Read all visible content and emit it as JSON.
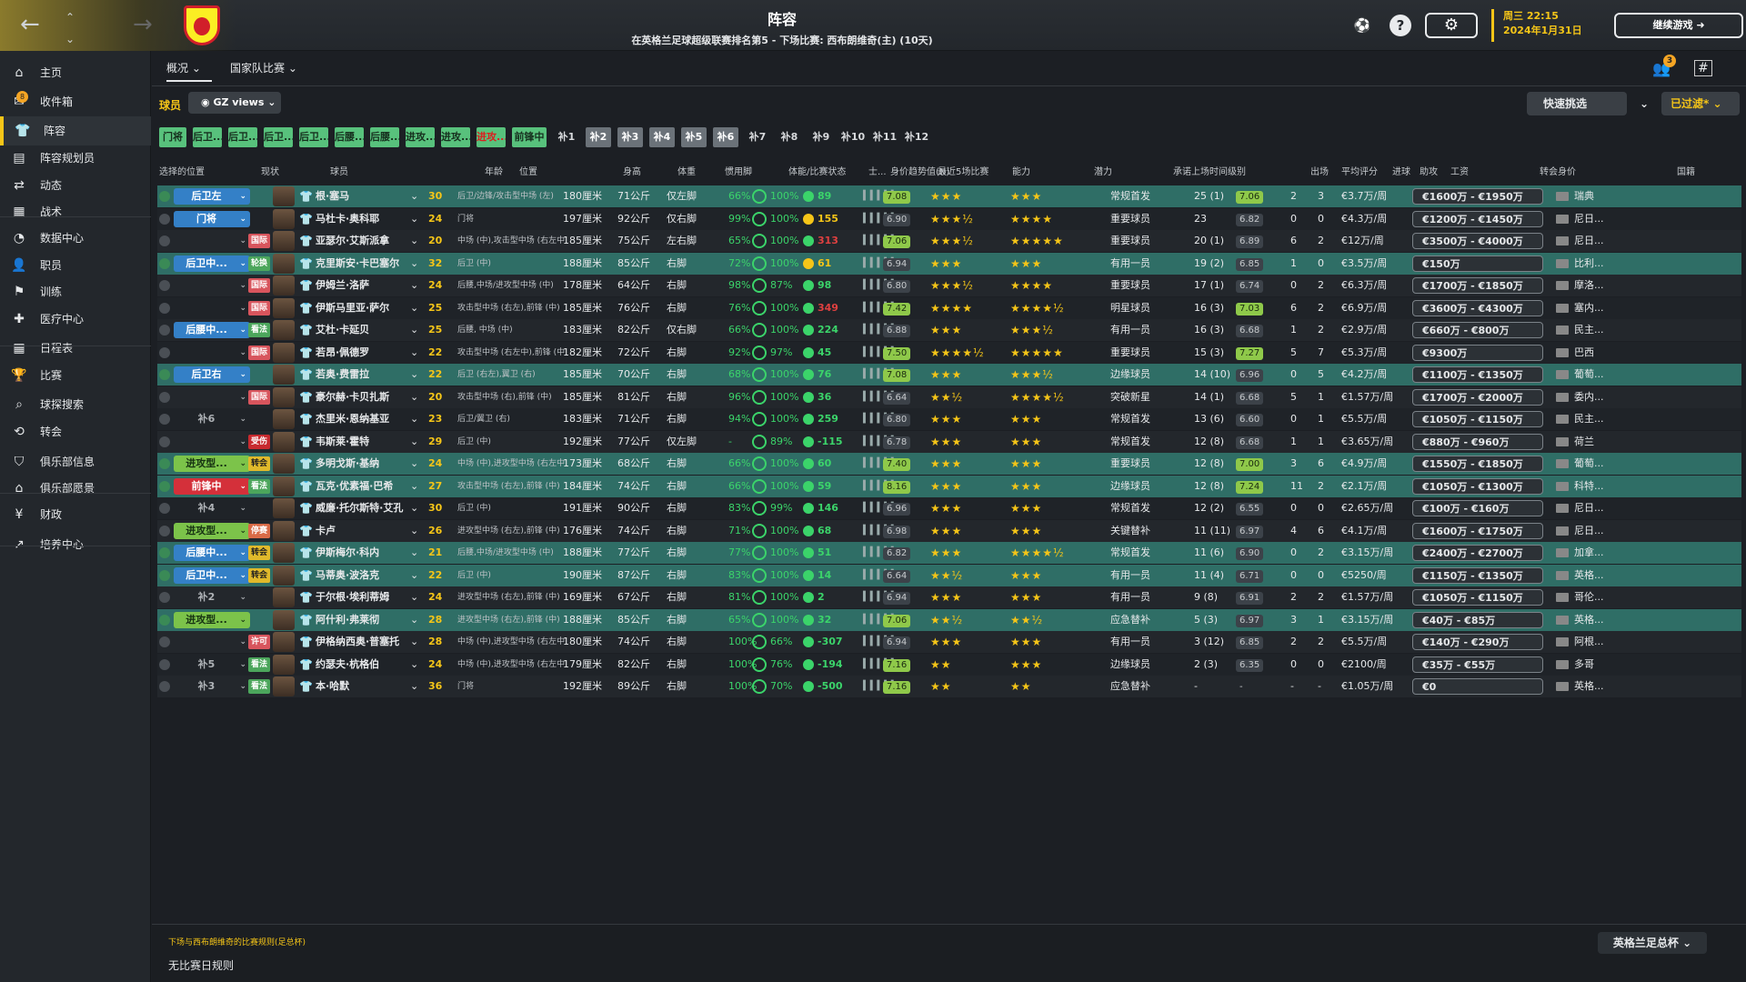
{
  "header": {
    "title": "阵容",
    "subtitle": "在英格兰足球超级联赛排名第5 - 下场比赛: 西布朗维奇(主) (10天)",
    "date_line1": "周三 22:15",
    "date_line2": "2024年1月31日",
    "continue_label": "继续游戏",
    "notif_count": "3",
    "back_icon": "←",
    "forward_icon": "→"
  },
  "sidebar": {
    "items": [
      {
        "label": "主页",
        "icon": "home-icon"
      },
      {
        "label": "收件箱",
        "icon": "inbox-icon",
        "badge": "8"
      },
      {
        "label": "阵容",
        "icon": "squad-icon",
        "active": true
      },
      {
        "label": "阵容规划员",
        "icon": "planner-icon"
      },
      {
        "label": "动态",
        "icon": "dynamics-icon"
      },
      {
        "label": "战术",
        "icon": "tactics-icon"
      },
      {
        "label": "数据中心",
        "icon": "data-icon"
      },
      {
        "label": "职员",
        "icon": "staff-icon"
      },
      {
        "label": "训练",
        "icon": "training-icon"
      },
      {
        "label": "医疗中心",
        "icon": "medical-icon"
      },
      {
        "label": "日程表",
        "icon": "calendar-icon"
      },
      {
        "label": "比赛",
        "icon": "trophy-icon"
      },
      {
        "label": "球探搜索",
        "icon": "scouting-icon"
      },
      {
        "label": "转会",
        "icon": "transfer-icon"
      },
      {
        "label": "俱乐部信息",
        "icon": "shield-icon"
      },
      {
        "label": "俱乐部愿景",
        "icon": "vision-icon"
      },
      {
        "label": "财政",
        "icon": "finance-icon"
      },
      {
        "label": "培养中心",
        "icon": "development-icon"
      }
    ]
  },
  "tabs": [
    {
      "label": "概况"
    },
    {
      "label": "国家队比赛"
    }
  ],
  "toolbar": {
    "players_label": "球员",
    "view_label": "GZ views",
    "quick_pick": "快速挑选",
    "filtered": "已过滤*"
  },
  "chips": [
    "门将",
    "后卫...",
    "后卫...",
    "后卫...",
    "后卫...",
    "后腰...",
    "后腰...",
    "进攻...",
    "进攻...",
    "进攻...",
    "前锋中",
    "补1",
    "补2",
    "补3",
    "补4",
    "补5",
    "补6",
    "补7",
    "补8",
    "补9",
    "补10",
    "补11",
    "补12"
  ],
  "columns": {
    "selpos": "选择的位置",
    "status": "现状",
    "player": "球员",
    "age": "年龄",
    "position": "位置",
    "height": "身高",
    "weight": "体重",
    "foot": "惯用脚",
    "fitness": "体能/比赛状态",
    "sharp": "士...",
    "trend": "身价趋势值(N)",
    "last5": "最近5场比赛",
    "ability": "能力",
    "potential": "潜力",
    "playing_time": "承诺上场时间级别",
    "apps": "出场",
    "avg": "平均评分",
    "goals": "进球",
    "assists": "助攻",
    "wage": "工资",
    "value": "转会身价",
    "nation": "国籍"
  },
  "players": [
    {
      "sel": "后卫左",
      "selc": "blue",
      "tag": "",
      "name": "根·塞马",
      "age": "30",
      "pos": "后卫/边锋/攻击型中场 (左)",
      "h": "180厘米",
      "w": "71公斤",
      "foot": "仅左脚",
      "fit": "66%",
      "cond": "100%",
      "form": "89",
      "formc": "g",
      "avgl": "7.08",
      "avglc": "g",
      "ab": "★★★",
      "pot": "★★★",
      "pt": "常规首发",
      "apps": "25 (1)",
      "avg": "7.06",
      "avgc": "g",
      "g": "2",
      "a": "3",
      "wage": "€3.7万/周",
      "val": "€1600万 - €1950万",
      "nat": "瑞典",
      "rowc": "sel"
    },
    {
      "sel": "门将",
      "selc": "blue",
      "tag": "",
      "name": "马杜卡·奥科耶",
      "age": "24",
      "pos": "门将",
      "h": "197厘米",
      "w": "92公斤",
      "foot": "仅右脚",
      "fit": "99%",
      "cond": "100%",
      "form": "155",
      "formc": "y",
      "avgl": "6.90",
      "avglc": "d",
      "ab": "★★★½",
      "pot": "★★★★",
      "pt": "重要球员",
      "apps": "23",
      "avg": "6.82",
      "avgc": "d",
      "g": "0",
      "a": "0",
      "wage": "€4.3万/周",
      "val": "€1200万 - €1450万",
      "nat": "尼日...",
      "rowc": "plain"
    },
    {
      "sel": "",
      "selc": "none",
      "tag": "国际",
      "tagc": "int",
      "name": "亚瑟尔·艾斯派拿",
      "age": "20",
      "pos": "中场 (中),攻击型中场 (右左中)",
      "h": "185厘米",
      "w": "75公斤",
      "foot": "左右脚",
      "fit": "65%",
      "cond": "100%",
      "form": "313",
      "formc": "r",
      "avgl": "7.06",
      "avglc": "g",
      "ab": "★★★½",
      "pot": "★★★★★",
      "pt": "重要球员",
      "apps": "20 (1)",
      "avg": "6.89",
      "avgc": "d",
      "g": "6",
      "a": "2",
      "wage": "€12万/周",
      "val": "€3500万 - €4000万",
      "nat": "尼日...",
      "rowc": "alt"
    },
    {
      "sel": "后卫中...",
      "selc": "blue",
      "tag": "轮换",
      "tagc": "rot",
      "name": "克里斯安·卡巴塞尔",
      "age": "32",
      "pos": "后卫 (中)",
      "h": "188厘米",
      "w": "85公斤",
      "foot": "右脚",
      "fit": "72%",
      "cond": "100%",
      "form": "61",
      "formc": "y",
      "avgl": "6.94",
      "avglc": "d",
      "ab": "★★★",
      "pot": "★★★",
      "pt": "有用一员",
      "apps": "19 (2)",
      "avg": "6.85",
      "avgc": "d",
      "g": "1",
      "a": "0",
      "wage": "€3.5万/周",
      "val": "€150万",
      "nat": "比利...",
      "rowc": "sel"
    },
    {
      "sel": "",
      "selc": "none",
      "tag": "国际",
      "tagc": "int",
      "name": "伊姆兰·洛萨",
      "age": "24",
      "pos": "后腰,中场/进攻型中场 (中)",
      "h": "178厘米",
      "w": "64公斤",
      "foot": "右脚",
      "fit": "98%",
      "cond": "87%",
      "form": "98",
      "formc": "g",
      "avgl": "6.80",
      "avglc": "d",
      "ab": "★★★½",
      "pot": "★★★★",
      "pt": "重要球员",
      "apps": "17 (1)",
      "avg": "6.74",
      "avgc": "d",
      "g": "0",
      "a": "2",
      "wage": "€6.3万/周",
      "val": "€1700万 - €1850万",
      "nat": "摩洛...",
      "rowc": "alt"
    },
    {
      "sel": "",
      "selc": "none",
      "tag": "国际",
      "tagc": "int",
      "name": "伊斯马里亚·萨尔",
      "age": "25",
      "pos": "攻击型中场 (右左),前锋 (中)",
      "h": "185厘米",
      "w": "76公斤",
      "foot": "右脚",
      "fit": "76%",
      "cond": "100%",
      "form": "349",
      "formc": "r",
      "avgl": "7.42",
      "avglc": "g",
      "ab": "★★★★",
      "pot": "★★★★½",
      "pt": "明星球员",
      "apps": "16 (3)",
      "avg": "7.03",
      "avgc": "g",
      "g": "6",
      "a": "2",
      "wage": "€6.9万/周",
      "val": "€3600万 - €4300万",
      "nat": "塞内...",
      "rowc": "plain"
    },
    {
      "sel": "后腰中...",
      "selc": "blue",
      "tag": "看法",
      "tagc": "rot",
      "name": "艾杜·卡延贝",
      "age": "25",
      "pos": "后腰, 中场 (中)",
      "h": "183厘米",
      "w": "82公斤",
      "foot": "仅右脚",
      "fit": "66%",
      "cond": "100%",
      "form": "224",
      "formc": "g",
      "avgl": "6.88",
      "avglc": "d",
      "ab": "★★★",
      "pot": "★★★½",
      "pt": "有用一员",
      "apps": "16 (3)",
      "avg": "6.68",
      "avgc": "d",
      "g": "1",
      "a": "2",
      "wage": "€2.9万/周",
      "val": "€660万 - €800万",
      "nat": "民主...",
      "rowc": "alt"
    },
    {
      "sel": "",
      "selc": "none",
      "tag": "国际",
      "tagc": "int",
      "name": "若昂·佩德罗",
      "age": "22",
      "pos": "攻击型中场 (右左中),前锋 (中)",
      "h": "182厘米",
      "w": "72公斤",
      "foot": "右脚",
      "fit": "92%",
      "cond": "97%",
      "form": "45",
      "formc": "g",
      "avgl": "7.50",
      "avglc": "g",
      "ab": "★★★★½",
      "pot": "★★★★★",
      "pt": "重要球员",
      "apps": "15 (3)",
      "avg": "7.27",
      "avgc": "g",
      "g": "5",
      "a": "7",
      "wage": "€5.3万/周",
      "val": "€9300万",
      "nat": "巴西",
      "rowc": "plain"
    },
    {
      "sel": "后卫右",
      "selc": "blue",
      "tag": "",
      "name": "若奥·费雷拉",
      "age": "22",
      "pos": "后卫 (右左),翼卫 (右)",
      "h": "185厘米",
      "w": "70公斤",
      "foot": "右脚",
      "fit": "68%",
      "cond": "100%",
      "form": "76",
      "formc": "g",
      "avgl": "7.08",
      "avglc": "g",
      "ab": "★★★",
      "pot": "★★★½",
      "pt": "边缘球员",
      "apps": "14 (10)",
      "avg": "6.96",
      "avgc": "d",
      "g": "0",
      "a": "5",
      "wage": "€4.2万/周",
      "val": "€1100万 - €1350万",
      "nat": "葡萄...",
      "rowc": "sel"
    },
    {
      "sel": "",
      "selc": "none",
      "tag": "国际",
      "tagc": "int",
      "name": "豪尔赫·卡贝扎斯",
      "age": "20",
      "pos": "攻击型中场 (右),前锋 (中)",
      "h": "185厘米",
      "w": "81公斤",
      "foot": "右脚",
      "fit": "96%",
      "cond": "100%",
      "form": "36",
      "formc": "g",
      "avgl": "6.64",
      "avglc": "d",
      "ab": "★★½",
      "pot": "★★★★½",
      "pt": "突破新星",
      "apps": "14 (1)",
      "avg": "6.68",
      "avgc": "d",
      "g": "5",
      "a": "1",
      "wage": "€1.57万/周",
      "val": "€1700万 - €2000万",
      "nat": "委内...",
      "rowc": "alt"
    },
    {
      "sel": "补6",
      "selc": "none",
      "tag": "",
      "name": "杰里米·恩纳基亚",
      "age": "23",
      "pos": "后卫/翼卫 (右)",
      "h": "183厘米",
      "w": "71公斤",
      "foot": "右脚",
      "fit": "94%",
      "cond": "100%",
      "form": "259",
      "formc": "g",
      "avgl": "6.80",
      "avglc": "d",
      "ab": "★★★",
      "pot": "★★★",
      "pt": "常规首发",
      "apps": "13 (6)",
      "avg": "6.60",
      "avgc": "d",
      "g": "0",
      "a": "1",
      "wage": "€5.5万/周",
      "val": "€1050万 - €1150万",
      "nat": "民主...",
      "rowc": "plain"
    },
    {
      "sel": "",
      "selc": "none",
      "tag": "受伤",
      "tagc": "inj",
      "name": "韦斯莱·霍特",
      "age": "29",
      "pos": "后卫 (中)",
      "h": "192厘米",
      "w": "77公斤",
      "foot": "仅左脚",
      "fit": "-",
      "cond": "89%",
      "form": "-115",
      "formc": "g",
      "avgl": "6.78",
      "avglc": "d",
      "ab": "★★★",
      "pot": "★★★",
      "pt": "常规首发",
      "apps": "12 (8)",
      "avg": "6.68",
      "avgc": "d",
      "g": "1",
      "a": "1",
      "wage": "€3.65万/周",
      "val": "€880万 - €960万",
      "nat": "荷兰",
      "rowc": "alt"
    },
    {
      "sel": "进攻型...",
      "selc": "green",
      "tag": "转会",
      "tagc": "trans",
      "name": "多明戈斯·基纳",
      "age": "24",
      "pos": "中场 (中),进攻型中场 (右左中)",
      "h": "173厘米",
      "w": "68公斤",
      "foot": "右脚",
      "fit": "66%",
      "cond": "100%",
      "form": "60",
      "formc": "g",
      "avgl": "7.40",
      "avglc": "g",
      "ab": "★★★",
      "pot": "★★★",
      "pt": "重要球员",
      "apps": "12 (8)",
      "avg": "7.00",
      "avgc": "g",
      "g": "3",
      "a": "6",
      "wage": "€4.9万/周",
      "val": "€1550万 - €1850万",
      "nat": "葡萄...",
      "rowc": "sel"
    },
    {
      "sel": "前锋中",
      "selc": "red",
      "tag": "看法",
      "tagc": "rot",
      "name": "瓦克·优素福·巴希",
      "age": "27",
      "pos": "攻击型中场 (右左),前锋 (中)",
      "h": "184厘米",
      "w": "74公斤",
      "foot": "右脚",
      "fit": "66%",
      "cond": "100%",
      "form": "59",
      "formc": "g",
      "avgl": "8.16",
      "avglc": "g",
      "ab": "★★★",
      "pot": "★★★",
      "pt": "边缘球员",
      "apps": "12 (8)",
      "avg": "7.24",
      "avgc": "g",
      "g": "11",
      "a": "2",
      "wage": "€2.1万/周",
      "val": "€1050万 - €1300万",
      "nat": "科特...",
      "rowc": "sel"
    },
    {
      "sel": "补4",
      "selc": "none",
      "tag": "",
      "name": "威廉·托尔斯特·艾孔",
      "age": "30",
      "pos": "后卫 (中)",
      "h": "191厘米",
      "w": "90公斤",
      "foot": "右脚",
      "fit": "83%",
      "cond": "99%",
      "form": "146",
      "formc": "g",
      "avgl": "6.96",
      "avglc": "d",
      "ab": "★★★",
      "pot": "★★★",
      "pt": "常规首发",
      "apps": "12 (2)",
      "avg": "6.55",
      "avgc": "d",
      "g": "0",
      "a": "0",
      "wage": "€2.65万/周",
      "val": "€100万 - €160万",
      "nat": "尼日...",
      "rowc": "plain"
    },
    {
      "sel": "进攻型...",
      "selc": "green",
      "tag": "停赛",
      "tagc": "loan",
      "name": "卡卢",
      "age": "26",
      "pos": "进攻型中场 (右左),前锋 (中)",
      "h": "176厘米",
      "w": "74公斤",
      "foot": "右脚",
      "fit": "71%",
      "cond": "100%",
      "form": "68",
      "formc": "g",
      "avgl": "6.98",
      "avglc": "d",
      "ab": "★★★",
      "pot": "★★★",
      "pt": "关键替补",
      "apps": "11 (11)",
      "avg": "6.97",
      "avgc": "d",
      "g": "4",
      "a": "6",
      "wage": "€4.1万/周",
      "val": "€1600万 - €1750万",
      "nat": "尼日...",
      "rowc": "alt"
    },
    {
      "sel": "后腰中...",
      "selc": "blue",
      "tag": "转会",
      "tagc": "trans",
      "name": "伊斯梅尔·科内",
      "age": "21",
      "pos": "后腰,中场/进攻型中场 (中)",
      "h": "188厘米",
      "w": "77公斤",
      "foot": "右脚",
      "fit": "77%",
      "cond": "100%",
      "form": "51",
      "formc": "g",
      "avgl": "6.82",
      "avglc": "d",
      "ab": "★★★",
      "pot": "★★★★½",
      "pt": "常规首发",
      "apps": "11 (6)",
      "avg": "6.90",
      "avgc": "d",
      "g": "0",
      "a": "2",
      "wage": "€3.15万/周",
      "val": "€2400万 - €2700万",
      "nat": "加拿...",
      "rowc": "sel"
    },
    {
      "sel": "后卫中...",
      "selc": "blue",
      "tag": "转会",
      "tagc": "trans",
      "name": "马蒂奥·波洛克",
      "age": "22",
      "pos": "后卫 (中)",
      "h": "190厘米",
      "w": "87公斤",
      "foot": "右脚",
      "fit": "83%",
      "cond": "100%",
      "form": "14",
      "formc": "g",
      "avgl": "6.64",
      "avglc": "d",
      "ab": "★★½",
      "pot": "★★★",
      "pt": "有用一员",
      "apps": "11 (4)",
      "avg": "6.71",
      "avgc": "d",
      "g": "0",
      "a": "0",
      "wage": "€5250/周",
      "val": "€1150万 - €1350万",
      "nat": "英格...",
      "rowc": "sel"
    },
    {
      "sel": "补2",
      "selc": "none",
      "tag": "",
      "name": "于尔根·埃利蒂姆",
      "age": "24",
      "pos": "进攻型中场 (右左),前锋 (中)",
      "h": "169厘米",
      "w": "67公斤",
      "foot": "右脚",
      "fit": "81%",
      "cond": "100%",
      "form": "2",
      "formc": "g",
      "avgl": "6.94",
      "avglc": "d",
      "ab": "★★★",
      "pot": "★★★",
      "pt": "有用一员",
      "apps": "9 (8)",
      "avg": "6.91",
      "avgc": "d",
      "g": "2",
      "a": "2",
      "wage": "€1.57万/周",
      "val": "€1050万 - €1150万",
      "nat": "哥伦...",
      "rowc": "alt"
    },
    {
      "sel": "进攻型...",
      "selc": "green",
      "tag": "",
      "name": "阿什利·弗莱彻",
      "age": "28",
      "pos": "进攻型中场 (右左),前锋 (中)",
      "h": "188厘米",
      "w": "85公斤",
      "foot": "右脚",
      "fit": "65%",
      "cond": "100%",
      "form": "32",
      "formc": "g",
      "avgl": "7.06",
      "avglc": "g",
      "ab": "★★½",
      "pot": "★★½",
      "pt": "应急替补",
      "apps": "5 (3)",
      "avg": "6.97",
      "avgc": "d",
      "g": "3",
      "a": "1",
      "wage": "€3.15万/周",
      "val": "€40万 - €85万",
      "nat": "英格...",
      "rowc": "sel"
    },
    {
      "sel": "",
      "selc": "none",
      "tag": "许可",
      "tagc": "int",
      "name": "伊格纳西奥·普塞托",
      "age": "28",
      "pos": "中场 (中),进攻型中场 (右左中)",
      "h": "180厘米",
      "w": "74公斤",
      "foot": "右脚",
      "fit": "100%",
      "cond": "66%",
      "form": "-307",
      "formc": "g",
      "avgl": "6.94",
      "avglc": "d",
      "ab": "★★★",
      "pot": "★★★",
      "pt": "有用一员",
      "apps": "3 (12)",
      "avg": "6.85",
      "avgc": "d",
      "g": "2",
      "a": "2",
      "wage": "€5.5万/周",
      "val": "€140万 - €290万",
      "nat": "阿根...",
      "rowc": "alt"
    },
    {
      "sel": "补5",
      "selc": "none",
      "tag": "看法",
      "tagc": "rot",
      "name": "约瑟夫·杭格伯",
      "age": "24",
      "pos": "中场 (中),进攻型中场 (右左中)",
      "h": "179厘米",
      "w": "82公斤",
      "foot": "右脚",
      "fit": "100%",
      "cond": "76%",
      "form": "-194",
      "formc": "g",
      "avgl": "7.16",
      "avglc": "g",
      "ab": "★★",
      "pot": "★★★",
      "pt": "边缘球员",
      "apps": "2 (3)",
      "avg": "6.35",
      "avgc": "d",
      "g": "0",
      "a": "0",
      "wage": "€2100/周",
      "val": "€35万 - €55万",
      "nat": "多哥",
      "rowc": "plain"
    },
    {
      "sel": "补3",
      "selc": "none",
      "tag": "看法",
      "tagc": "rot",
      "name": "本·哈默",
      "age": "36",
      "pos": "门将",
      "h": "192厘米",
      "w": "89公斤",
      "foot": "右脚",
      "fit": "100%",
      "cond": "70%",
      "form": "-500",
      "formc": "g",
      "avgl": "7.16",
      "avglc": "g",
      "ab": "★★",
      "pot": "★★",
      "pt": "应急替补",
      "apps": "-",
      "avg": "-",
      "avgc": "none",
      "g": "-",
      "a": "-",
      "wage": "€1.05万/周",
      "val": "€0",
      "nat": "英格...",
      "rowc": "alt"
    }
  ],
  "footer": {
    "note": "下场与西布朗维奇的比赛规则(足总杯)",
    "rule": "无比赛日规则",
    "cup": "英格兰足总杯"
  },
  "colors": {
    "accent": "#f5c518",
    "selected_row": "#2f6e66",
    "chip_green": "#58c17c"
  }
}
